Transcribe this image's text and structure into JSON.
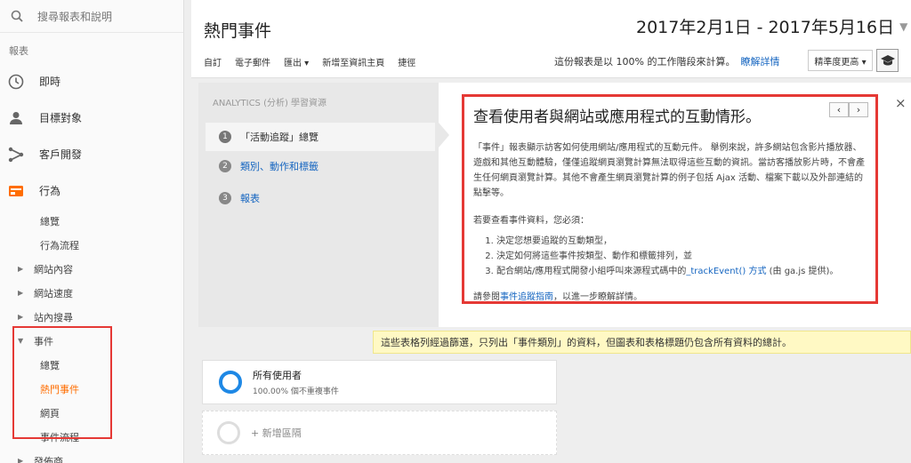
{
  "sidebar": {
    "search_placeholder": "搜尋報表和說明",
    "section": "報表",
    "main_items": [
      {
        "label": "即時"
      },
      {
        "label": "目標對象"
      },
      {
        "label": "客戶開發"
      },
      {
        "label": "行為"
      }
    ],
    "behavior_sub": [
      "總覽",
      "行為流程"
    ],
    "expandable": [
      "網站內容",
      "網站速度",
      "站內搜尋"
    ],
    "events": {
      "label": "事件",
      "children": [
        "總覽",
        "熱門事件",
        "網頁",
        "事件流程"
      ],
      "active": "熱門事件"
    },
    "publisher": "發佈商"
  },
  "header": {
    "title": "熱門事件",
    "date_range": "2017年2月1日 - 2017年5月16日"
  },
  "toolbar": {
    "custom": "自訂",
    "email": "電子郵件",
    "export": "匯出 ▾",
    "add_dashboard": "新增至資訊主頁",
    "shortcut": "捷徑"
  },
  "report_note": {
    "text": "這份報表是以 100% 的工作階段來計算。",
    "link": "瞭解詳情",
    "precision": "精準度更高 ▾"
  },
  "learn": {
    "label": "ANALYTICS (分析) 學習資源",
    "steps": [
      {
        "num": "1",
        "label": "「活動追蹤」總覽"
      },
      {
        "num": "2",
        "label": "類別、動作和標籤"
      },
      {
        "num": "3",
        "label": "報表"
      }
    ],
    "title": "查看使用者與網站或應用程式的互動情形。",
    "para1": "「事件」報表顯示訪客如何使用網站/應用程式的互動元件。 舉例來說，許多網站包含影片播放器、遊戲和其他互動體驗，僅僅追蹤網頁瀏覽計算無法取得這些互動的資訊。當訪客播放影片時，不會產生任何網頁瀏覽計算。其他不會產生網頁瀏覽計算的例子包括 Ajax 活動、檔案下載以及外部連結的點擊等。",
    "para2": "若要查看事件資料，您必須：",
    "list1": "決定您想要追蹤的互動類型，",
    "list2": "決定如何將這些事件按類型、動作和標籤排列，並",
    "list3_pre": "配合網站/應用程式開發小組呼叫來源程式碼中的",
    "list3_link": "_trackEvent() 方式",
    "list3_post": " (由 ga.js 提供)。",
    "para3_pre": "請參閱",
    "para3_link": "事件追蹤指南",
    "para3_post": "，以進一步瞭解詳情。",
    "prev": "‹",
    "next": "›",
    "close": "×"
  },
  "notice": "這些表格列經過篩選，只列出「事件類別」的資料，但圖表和表格標題仍包含所有資料的總計。",
  "segment": {
    "name": "所有使用者",
    "sub": "100.00% 個不重複事件",
    "add": "+ 新增區隔"
  }
}
